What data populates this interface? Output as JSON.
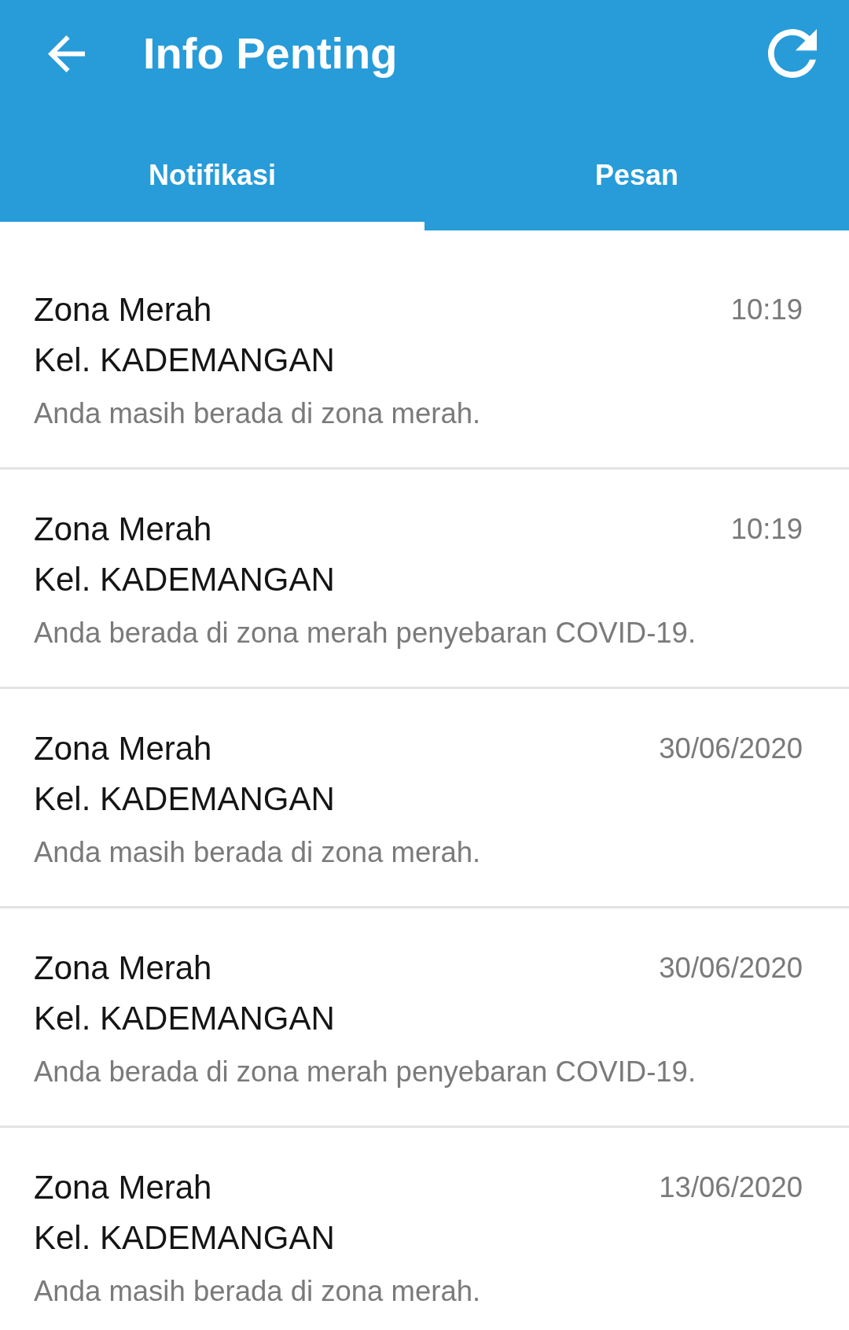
{
  "toolbar": {
    "title": "Info Penting"
  },
  "tabs": [
    {
      "label": "Notifikasi",
      "selected": true
    },
    {
      "label": "Pesan",
      "selected": false
    }
  ],
  "notifications": [
    {
      "title": "Zona Merah",
      "area": "Kel. KADEMANGAN",
      "message": "Anda masih berada di zona merah.",
      "time": "10:19"
    },
    {
      "title": "Zona Merah",
      "area": "Kel. KADEMANGAN",
      "message": "Anda berada di zona merah penyebaran COVID-19.",
      "time": "10:19"
    },
    {
      "title": "Zona Merah",
      "area": "Kel. KADEMANGAN",
      "message": "Anda masih berada di zona merah.",
      "time": "30/06/2020"
    },
    {
      "title": "Zona Merah",
      "area": "Kel. KADEMANGAN",
      "message": "Anda berada di zona merah penyebaran COVID-19.",
      "time": "30/06/2020"
    },
    {
      "title": "Zona Merah",
      "area": "Kel. KADEMANGAN",
      "message": "Anda masih berada di zona merah.",
      "time": "13/06/2020"
    }
  ]
}
